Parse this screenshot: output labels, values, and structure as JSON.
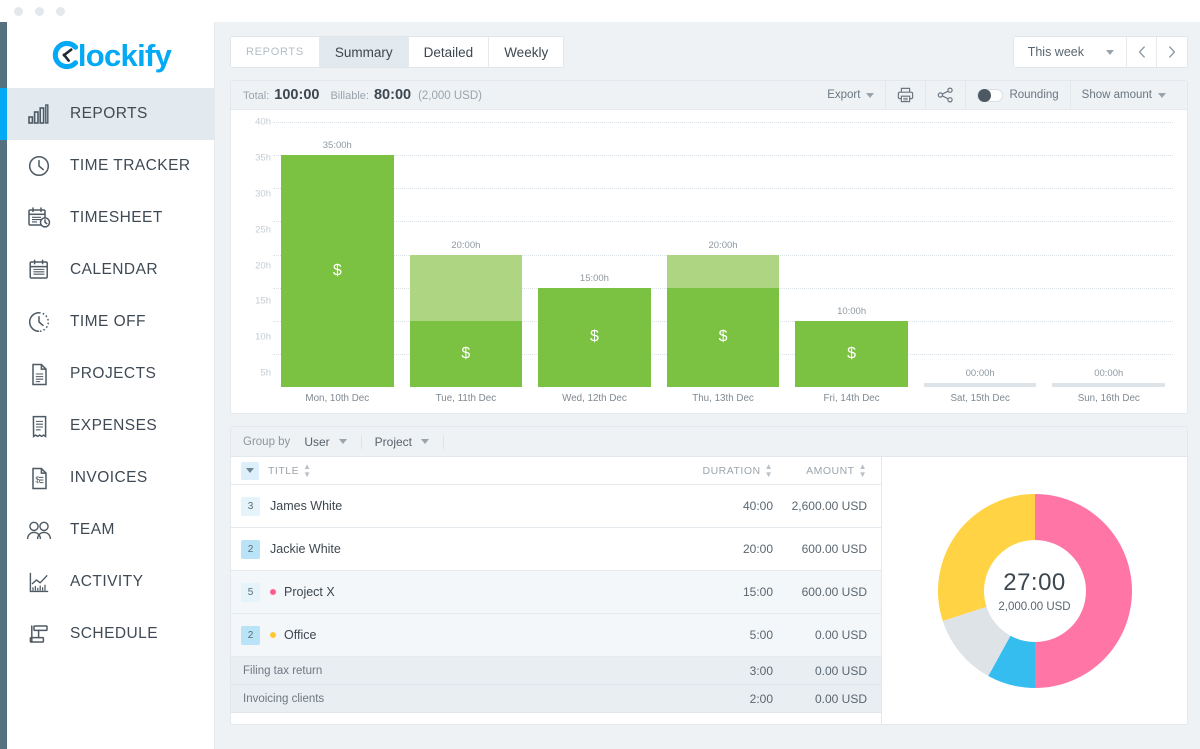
{
  "window": {
    "dots": 3
  },
  "sidebar": {
    "logo": "lockify",
    "logo_prefix": "C",
    "items": [
      {
        "label": "REPORTS",
        "icon": "bar-chart-icon",
        "active": true
      },
      {
        "label": "TIME TRACKER",
        "icon": "clock-icon",
        "active": false
      },
      {
        "label": "TIMESHEET",
        "icon": "calendar-clock-icon",
        "active": false
      },
      {
        "label": "CALENDAR",
        "icon": "calendar-icon",
        "active": false
      },
      {
        "label": "TIME OFF",
        "icon": "clock-dashed-icon",
        "active": false
      },
      {
        "label": "PROJECTS",
        "icon": "document-icon",
        "active": false
      },
      {
        "label": "EXPENSES",
        "icon": "receipt-icon",
        "active": false
      },
      {
        "label": "INVOICES",
        "icon": "invoice-icon",
        "active": false
      },
      {
        "label": "TEAM",
        "icon": "people-icon",
        "active": false
      },
      {
        "label": "ACTIVITY",
        "icon": "activity-chart-icon",
        "active": false
      },
      {
        "label": "SCHEDULE",
        "icon": "schedule-icon",
        "active": false
      }
    ]
  },
  "tabs": {
    "group_label": "REPORTS",
    "items": [
      {
        "label": "Summary",
        "selected": true
      },
      {
        "label": "Detailed",
        "selected": false
      },
      {
        "label": "Weekly",
        "selected": false
      }
    ]
  },
  "daterange": {
    "value": "This week",
    "prev_icon": "chevron-left-icon",
    "next_icon": "chevron-right-icon"
  },
  "summary_bar": {
    "total_label": "Total:",
    "total_value": "100:00",
    "billable_label": "Billable:",
    "billable_value": "80:00",
    "billable_amount": "(2,000 USD)",
    "export_label": "Export",
    "print_icon": "printer-icon",
    "share_icon": "share-icon",
    "rounding_label": "Rounding",
    "rounding_on": false,
    "show_amount_label": "Show amount"
  },
  "chart_data": {
    "type": "bar",
    "stacked": true,
    "title": "",
    "xlabel": "",
    "ylabel": "",
    "ylim": [
      0,
      40
    ],
    "grid": true,
    "legend_position": "none",
    "yticks": [
      "40h",
      "35h",
      "30h",
      "25h",
      "20h",
      "15h",
      "10h",
      "5h"
    ],
    "ytick_values": [
      40,
      35,
      30,
      25,
      20,
      15,
      10,
      5
    ],
    "categories": [
      "Mon, 10th Dec",
      "Tue, 11th Dec",
      "Wed, 12th Dec",
      "Thu, 13th Dec",
      "Fri, 14th Dec",
      "Sat, 15th Dec",
      "Sun, 16th Dec"
    ],
    "data_labels": [
      "35:00h",
      "20:00h",
      "15:00h",
      "20:00h",
      "10:00h",
      "00:00h",
      "00:00h"
    ],
    "totals": [
      35,
      20,
      15,
      20,
      10,
      0,
      0
    ],
    "series": [
      {
        "name": "Billable",
        "color": "#7cc242",
        "values": [
          35,
          10,
          15,
          15,
          10,
          0,
          0
        ]
      },
      {
        "name": "Non-billable",
        "color": "#aed581",
        "values": [
          0,
          10,
          0,
          5,
          0,
          0,
          0
        ]
      }
    ],
    "billable_marker": "$",
    "billable_marker_shown": [
      true,
      true,
      true,
      true,
      true,
      false,
      false
    ]
  },
  "groupby": {
    "label": "Group by",
    "primary": "User",
    "secondary": "Project"
  },
  "table": {
    "columns": {
      "title": "TITLE",
      "duration": "DURATION",
      "amount": "AMOUNT"
    },
    "rows": [
      {
        "count": "3",
        "badge": "light",
        "title": "James White",
        "dot": "",
        "duration": "40:00",
        "amount": "2,600.00 USD",
        "alt": false,
        "sub": false
      },
      {
        "count": "2",
        "badge": "strong",
        "title": "Jackie White",
        "dot": "",
        "duration": "20:00",
        "amount": "600.00 USD",
        "alt": false,
        "sub": false
      },
      {
        "count": "5",
        "badge": "light",
        "title": "Project X",
        "dot": "#ff5d8f",
        "duration": "15:00",
        "amount": "600.00 USD",
        "alt": true,
        "sub": false
      },
      {
        "count": "2",
        "badge": "strong",
        "title": "Office",
        "dot": "#ffc830",
        "duration": "5:00",
        "amount": "0.00 USD",
        "alt": true,
        "sub": false
      },
      {
        "count": "",
        "badge": "",
        "title": "Filing tax return",
        "dot": "",
        "duration": "3:00",
        "amount": "0.00 USD",
        "alt": false,
        "sub": true
      },
      {
        "count": "",
        "badge": "",
        "title": "Invoicing clients",
        "dot": "",
        "duration": "2:00",
        "amount": "0.00 USD",
        "alt": false,
        "sub": true
      }
    ]
  },
  "donut": {
    "center_value": "27:00",
    "center_amount": "2,000.00 USD",
    "segments": [
      {
        "name": "pink",
        "color": "#ff76a6",
        "percent": 50
      },
      {
        "name": "blue",
        "color": "#35bdf0",
        "percent": 8
      },
      {
        "name": "gray",
        "color": "#dde3e7",
        "percent": 12
      },
      {
        "name": "yellow",
        "color": "#ffd343",
        "percent": 30
      }
    ]
  },
  "colors": {
    "brand": "#03a9f4",
    "bar_billable": "#7cc242",
    "bar_nonbillable": "#aed581",
    "page_bg": "#eef2f5"
  }
}
